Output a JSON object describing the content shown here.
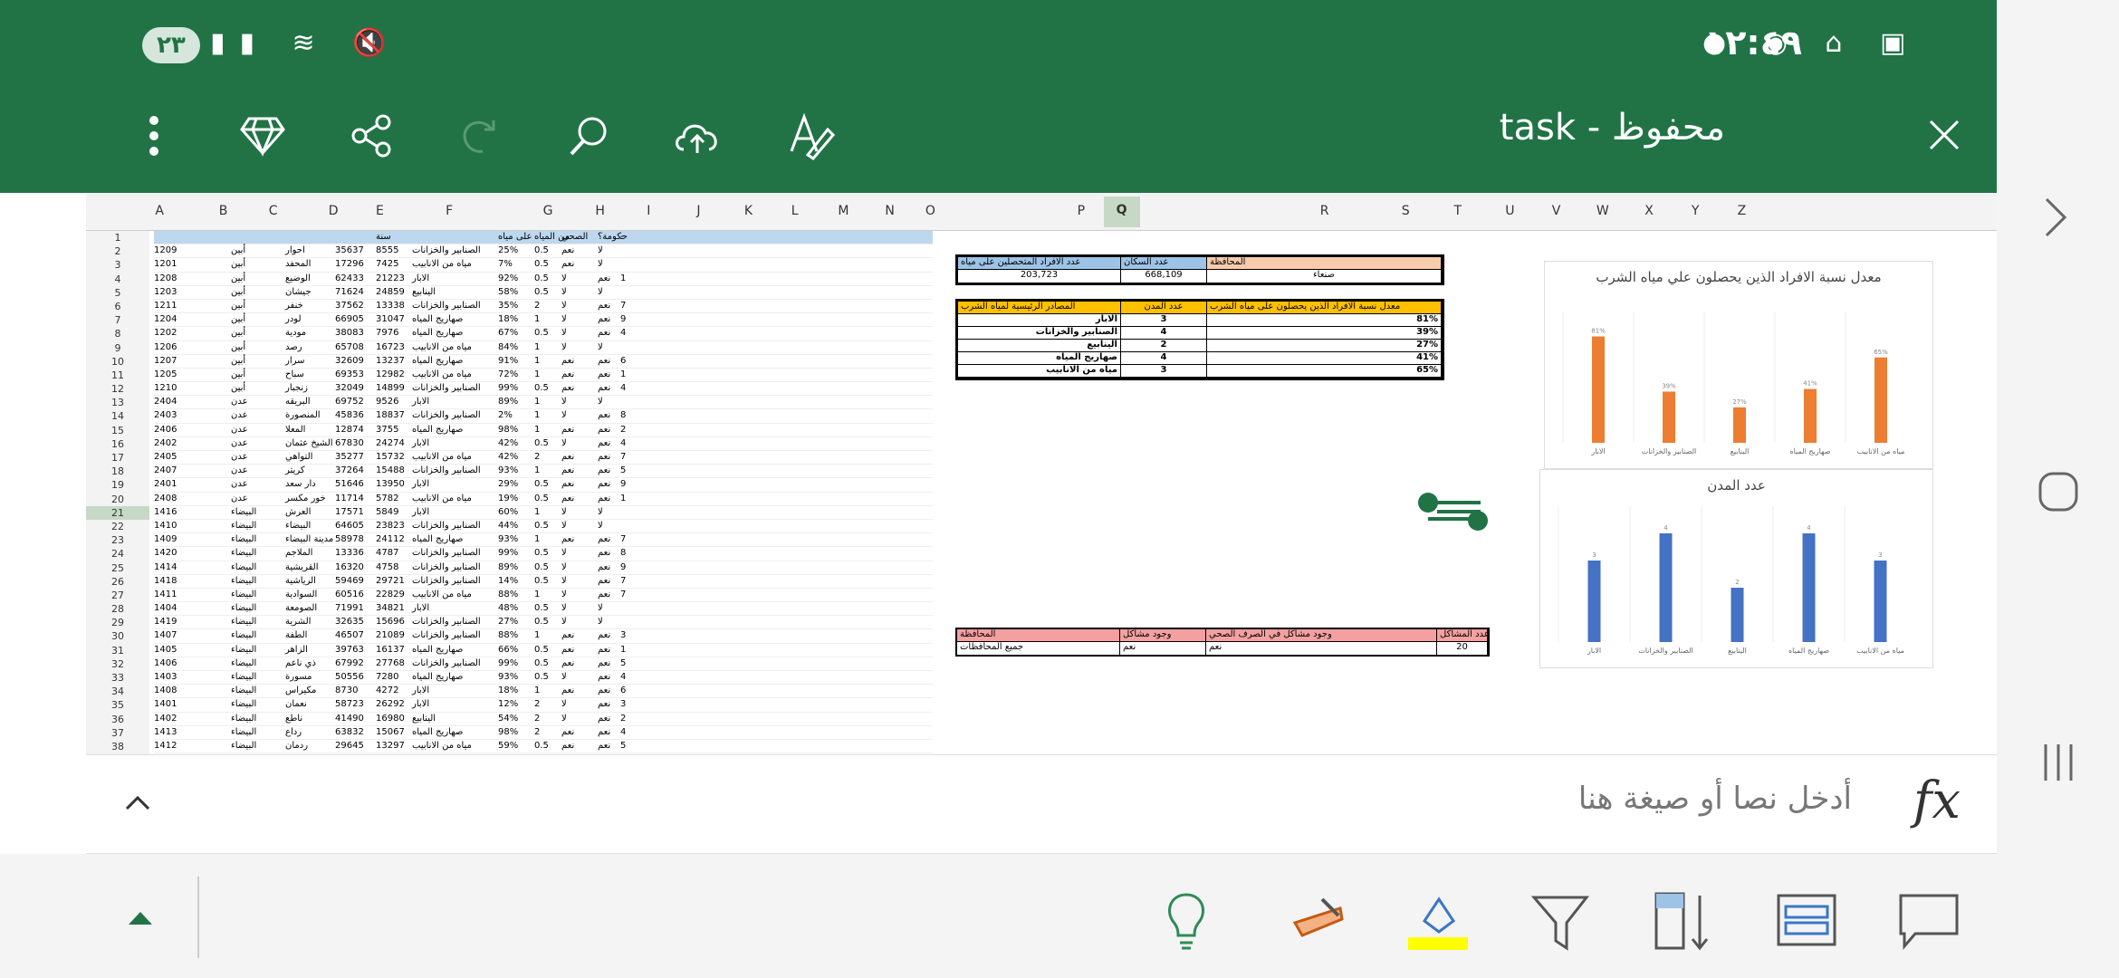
{
  "status": {
    "time": "١٢:٤٩",
    "battery": "٢٣"
  },
  "toolbar": {
    "title": "task - محفوظ"
  },
  "formula": {
    "placeholder": "أدخل نصا أو صيغة هنا",
    "fx": "fx"
  },
  "columns": [
    "A",
    "B",
    "C",
    "D",
    "E",
    "F",
    "G",
    "H",
    "I",
    "J",
    "K",
    "L",
    "M",
    "N",
    "O",
    "P",
    "Q",
    "R",
    "S",
    "T",
    "U",
    "V",
    "W",
    "X",
    "Y",
    "Z"
  ],
  "rows": [
    "1",
    "2",
    "3",
    "4",
    "5",
    "6",
    "7",
    "8",
    "9",
    "10",
    "11",
    "12",
    "13",
    "14",
    "15",
    "16",
    "17",
    "18",
    "19",
    "20",
    "21",
    "22",
    "23",
    "24",
    "25",
    "26",
    "27",
    "28",
    "29",
    "30",
    "31",
    "32",
    "33",
    "34",
    "35",
    "36",
    "37",
    "38"
  ],
  "data": [
    [
      "1209",
      "أبين",
      "احوار",
      "35637",
      "8555",
      "الصنابير والخزانات",
      "25%",
      "0.5",
      "نعم",
      "لا",
      ""
    ],
    [
      "1201",
      "أبين",
      "المحفد",
      "17296",
      "7425",
      "مياه من الانابيب",
      "7%",
      "0.5",
      "نعم",
      "لا",
      ""
    ],
    [
      "1208",
      "أبين",
      "الوضيع",
      "62433",
      "21223",
      "الابار",
      "92%",
      "0.5",
      "لا",
      "نعم",
      "1"
    ],
    [
      "1203",
      "أبين",
      "جيشان",
      "71624",
      "24859",
      "الينابيع",
      "58%",
      "0.5",
      "لا",
      "لا",
      ""
    ],
    [
      "1211",
      "أبين",
      "خنفر",
      "37562",
      "13338",
      "الصنابير والخزانات",
      "35%",
      "2",
      "لا",
      "نعم",
      "7"
    ],
    [
      "1204",
      "أبين",
      "لودر",
      "66905",
      "31047",
      "صهاريج المياه",
      "18%",
      "1",
      "لا",
      "نعم",
      "9"
    ],
    [
      "1202",
      "أبين",
      "مودية",
      "38083",
      "7976",
      "صهاريج المياه",
      "67%",
      "0.5",
      "لا",
      "نعم",
      "4"
    ],
    [
      "1206",
      "أبين",
      "رصد",
      "65708",
      "16723",
      "مياه من الانابيب",
      "84%",
      "1",
      "لا",
      "لا",
      ""
    ],
    [
      "1207",
      "أبين",
      "سرار",
      "32609",
      "13237",
      "صهاريج المياه",
      "91%",
      "1",
      "نعم",
      "نعم",
      "6"
    ],
    [
      "1205",
      "أبين",
      "سباح",
      "69353",
      "12982",
      "مياه من الانابيب",
      "72%",
      "1",
      "نعم",
      "نعم",
      "1"
    ],
    [
      "1210",
      "أبين",
      "زنجبار",
      "32049",
      "14899",
      "الصنابير والخزانات",
      "99%",
      "0.5",
      "نعم",
      "نعم",
      "4"
    ],
    [
      "2404",
      "عدن",
      "البريقه",
      "69752",
      "9526",
      "الابار",
      "89%",
      "1",
      "لا",
      "لا",
      ""
    ],
    [
      "2403",
      "عدن",
      "المنصورة",
      "45836",
      "18837",
      "الصنابير والخزانات",
      "2%",
      "1",
      "لا",
      "نعم",
      "8"
    ],
    [
      "2406",
      "عدن",
      "المعلا",
      "12874",
      "3755",
      "صهاريج المياه",
      "98%",
      "1",
      "نعم",
      "نعم",
      "2"
    ],
    [
      "2402",
      "عدن",
      "الشيخ عثمان",
      "67830",
      "24274",
      "الابار",
      "42%",
      "0.5",
      "لا",
      "نعم",
      "4"
    ],
    [
      "2405",
      "عدن",
      "التواهي",
      "35277",
      "15732",
      "مياه من الانابيب",
      "42%",
      "2",
      "نعم",
      "نعم",
      "7"
    ],
    [
      "2407",
      "عدن",
      "كريتر",
      "37264",
      "15488",
      "الصنابير والخزانات",
      "93%",
      "1",
      "نعم",
      "نعم",
      "5"
    ],
    [
      "2401",
      "عدن",
      "دار سعد",
      "51646",
      "13950",
      "الابار",
      "29%",
      "0.5",
      "نعم",
      "نعم",
      "9"
    ],
    [
      "2408",
      "عدن",
      "خور مكسر",
      "11714",
      "5782",
      "مياه من الانابيب",
      "19%",
      "0.5",
      "نعم",
      "نعم",
      "1"
    ],
    [
      "1416",
      "البيضاء",
      "العرش",
      "17571",
      "5849",
      "الابار",
      "60%",
      "1",
      "لا",
      "لا",
      ""
    ],
    [
      "1410",
      "البيضاء",
      "البيضاء",
      "64605",
      "23823",
      "الصنابير والخزانات",
      "44%",
      "0.5",
      "لا",
      "لا",
      ""
    ],
    [
      "1409",
      "البيضاء",
      "مدينة البيضاء",
      "58978",
      "24112",
      "صهاريج المياه",
      "93%",
      "1",
      "نعم",
      "نعم",
      "7"
    ],
    [
      "1420",
      "البيضاء",
      "الملاجم",
      "13336",
      "4787",
      "الصنابير والخزانات",
      "99%",
      "0.5",
      "لا",
      "نعم",
      "8"
    ],
    [
      "1414",
      "البيضاء",
      "القريشية",
      "16320",
      "4758",
      "الصنابير والخزانات",
      "89%",
      "0.5",
      "لا",
      "نعم",
      "9"
    ],
    [
      "1418",
      "البيضاء",
      "الرياشية",
      "59469",
      "29721",
      "الصنابير والخزانات",
      "14%",
      "0.5",
      "لا",
      "نعم",
      "7"
    ],
    [
      "1411",
      "البيضاء",
      "السوادية",
      "60516",
      "22829",
      "مياه من الانابيب",
      "88%",
      "1",
      "لا",
      "نعم",
      "7"
    ],
    [
      "1404",
      "البيضاء",
      "الصومعة",
      "71991",
      "34821",
      "الابار",
      "48%",
      "0.5",
      "لا",
      "لا",
      ""
    ],
    [
      "1419",
      "البيضاء",
      "الشرية",
      "32635",
      "15696",
      "الصنابير والخزانات",
      "27%",
      "0.5",
      "لا",
      "لا",
      ""
    ],
    [
      "1407",
      "البيضاء",
      "الطفة",
      "46507",
      "21089",
      "الصنابير والخزانات",
      "88%",
      "1",
      "نعم",
      "نعم",
      "3"
    ],
    [
      "1405",
      "البيضاء",
      "الزاهر",
      "39763",
      "16137",
      "صهاريج المياه",
      "66%",
      "0.5",
      "نعم",
      "نعم",
      "1"
    ],
    [
      "1406",
      "البيضاء",
      "ذي ناعم",
      "67992",
      "27768",
      "الصنابير والخزانات",
      "99%",
      "0.5",
      "نعم",
      "نعم",
      "5"
    ],
    [
      "1403",
      "البيضاء",
      "مسورة",
      "50556",
      "7280",
      "صهاريج المياه",
      "93%",
      "0.5",
      "لا",
      "نعم",
      "4"
    ],
    [
      "1408",
      "البيضاء",
      "مكيراس",
      "8730",
      "4272",
      "الابار",
      "18%",
      "1",
      "نعم",
      "نعم",
      "6"
    ],
    [
      "1401",
      "البيضاء",
      "نعمان",
      "58723",
      "26292",
      "الابار",
      "12%",
      "2",
      "لا",
      "نعم",
      "3"
    ],
    [
      "1402",
      "البيضاء",
      "ناطع",
      "41490",
      "16980",
      "الينابيع",
      "54%",
      "2",
      "لا",
      "نعم",
      "2"
    ],
    [
      "1413",
      "البيضاء",
      "رداع",
      "63832",
      "15067",
      "صهاريج المياه",
      "98%",
      "2",
      "نعم",
      "نعم",
      "4"
    ],
    [
      "1412",
      "البيضاء",
      "ردمان",
      "29645",
      "13297",
      "مياه من الانابيب",
      "59%",
      "0.5",
      "نعم",
      "نعم",
      "5"
    ]
  ],
  "header_cells": [
    "",
    "",
    "",
    "",
    "سنة",
    "",
    "على مياه",
    "من المياه",
    "الصحي",
    "حكومة؟",
    "-"
  ],
  "lookup": {
    "h1": [
      "المحافظة",
      "عدد السكان",
      "عدد الافراد المتحصلين على مياه"
    ],
    "v1": [
      "صنعاء",
      "668,109",
      "203,723"
    ],
    "h2": [
      "معدل نسبة الافراد الذين يحصلون على مياه الشرب",
      "عدد المدن",
      "المصادر الرئيسية لمياه الشرب"
    ],
    "rows": [
      [
        "81%",
        "3",
        "الابار"
      ],
      [
        "39%",
        "4",
        "الصنابير والخزانات"
      ],
      [
        "27%",
        "2",
        "الينابيع"
      ],
      [
        "41%",
        "4",
        "صهاريج المياه"
      ],
      [
        "65%",
        "3",
        "مياه من الانابيب"
      ]
    ],
    "h3": [
      "عدد المشاكل",
      "وجود مشاكل في الصرف الصحي",
      "وجود مشاكل",
      "المحافظة"
    ],
    "v3": [
      "20",
      "نعم",
      "نعم",
      "جميع المحافظات"
    ]
  },
  "chart_data": [
    {
      "type": "bar",
      "title": "معدل نسبة الافراد الذين يحصلون علي مياه الشرب",
      "categories": [
        "الابار",
        "الصنابير والخزانات",
        "الينابيع",
        "صهاريج المياه",
        "مياه من الانابيب"
      ],
      "values": [
        81,
        39,
        27,
        41,
        65
      ],
      "ylim": [
        0,
        100
      ],
      "color": "#ED7D31"
    },
    {
      "type": "bar",
      "title": "عدد المدن",
      "categories": [
        "الابار",
        "الصنابير والخزانات",
        "الينابيع",
        "صهاريج المياه",
        "مياه من الانابيب"
      ],
      "values": [
        3,
        4,
        2,
        4,
        3
      ],
      "ylim": [
        0,
        5
      ],
      "color": "#4472C4"
    }
  ],
  "icons": {
    "colors": {
      "header": "#217346",
      "selected_col": "#c6d9c6"
    }
  }
}
